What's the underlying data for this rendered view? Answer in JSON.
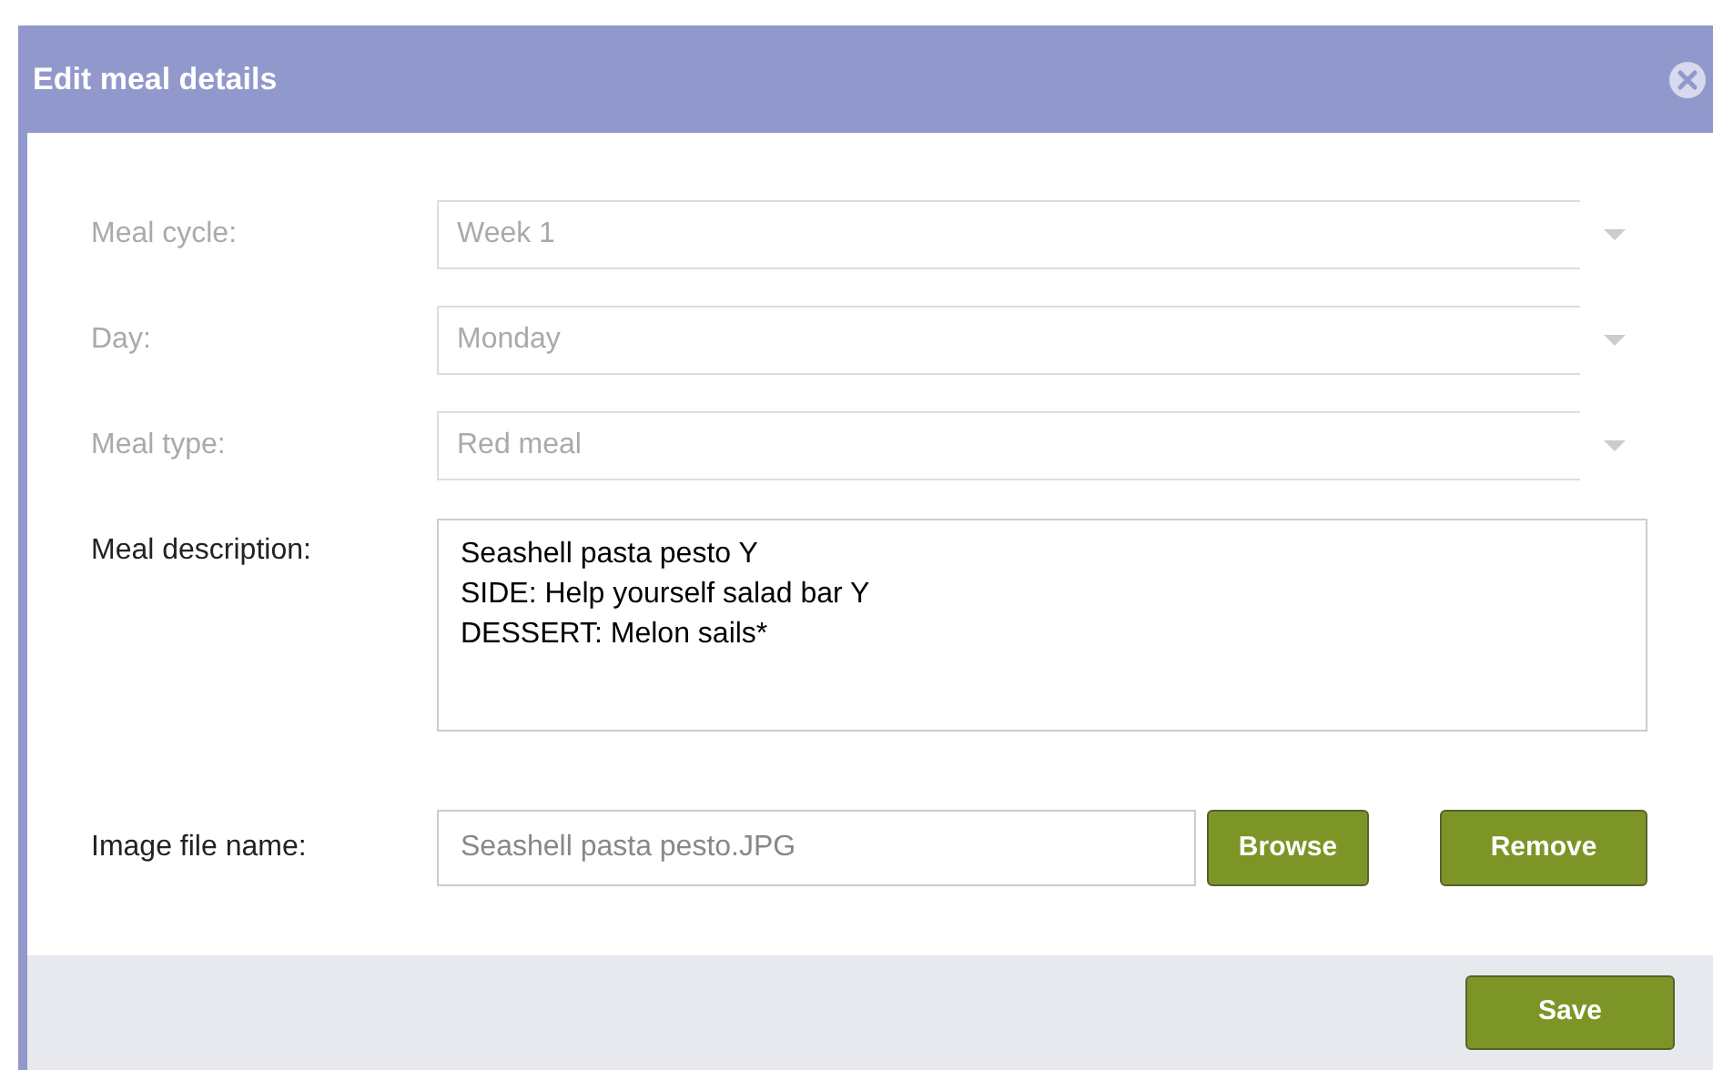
{
  "dialog": {
    "title": "Edit meal details"
  },
  "selects": [
    {
      "label": "Meal cycle:",
      "value": "Week 1",
      "disabled": true
    },
    {
      "label": "Day:",
      "value": "Monday",
      "disabled": true
    },
    {
      "label": "Meal type:",
      "value": "Red meal",
      "disabled": true
    }
  ],
  "description": {
    "label": "Meal description:",
    "value": "Seashell pasta pesto Y\nSIDE: Help yourself salad bar Y\nDESSERT: Melon sails*"
  },
  "image": {
    "label": "Image file name:",
    "placeholder": "Seashell pasta pesto.JPG",
    "buttons": [
      "Browse",
      "Remove"
    ]
  },
  "footer": {
    "buttons": [
      "Save"
    ]
  }
}
